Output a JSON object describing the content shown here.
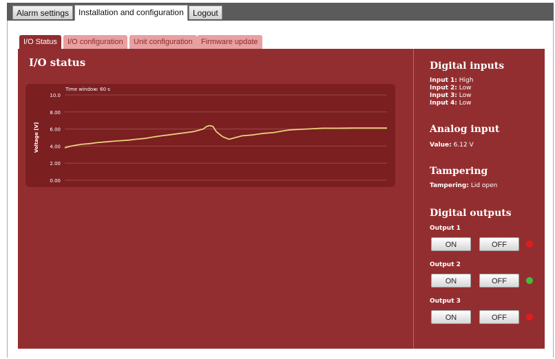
{
  "top_tabs": [
    "Alarm settings",
    "Installation and configuration",
    "Logout"
  ],
  "sub_tabs": [
    "I/O Status",
    "I/O configuration",
    "Unit configuration",
    "Firmware update"
  ],
  "main": {
    "title": "I/O status"
  },
  "chart_data": {
    "type": "line",
    "title": "Time window: 60 s",
    "ylabel": "Voltage [V]",
    "xlabel": "",
    "ylim": [
      0,
      10
    ],
    "ytick_labels": [
      "10.0",
      "8.00",
      "6.00",
      "4.00",
      "2.00",
      "0.00"
    ],
    "series": [
      {
        "x": [
          0,
          2,
          5,
          8,
          10,
          13,
          16,
          20,
          22,
          25,
          28,
          30,
          33,
          36,
          38,
          40,
          41,
          42,
          43,
          44,
          45,
          46,
          47,
          49,
          51,
          53,
          55,
          58,
          60,
          62,
          65,
          68,
          70,
          75,
          80,
          85,
          90,
          100
        ],
        "values": [
          3.8,
          4.0,
          4.2,
          4.3,
          4.4,
          4.5,
          4.6,
          4.7,
          4.8,
          4.9,
          5.1,
          5.2,
          5.35,
          5.5,
          5.6,
          5.7,
          5.8,
          5.9,
          6.0,
          6.3,
          6.4,
          6.3,
          5.7,
          5.1,
          4.8,
          5.0,
          5.2,
          5.3,
          5.4,
          5.5,
          5.6,
          5.8,
          5.9,
          6.0,
          6.1,
          6.1,
          6.12,
          6.12
        ]
      }
    ],
    "line_color": "#e8d27a"
  },
  "right": {
    "digital_inputs": {
      "title": "Digital inputs",
      "items": [
        {
          "label": "Input 1:",
          "value": "High"
        },
        {
          "label": "Input 2:",
          "value": "Low"
        },
        {
          "label": "Input 3:",
          "value": "Low"
        },
        {
          "label": "Input 4:",
          "value": "Low"
        }
      ]
    },
    "analog_input": {
      "title": "Analog input",
      "label": "Value:",
      "value": "6.12 V"
    },
    "tampering": {
      "title": "Tampering",
      "label": "Tampering:",
      "value": "Lid open"
    },
    "digital_outputs": {
      "title": "Digital outputs",
      "outputs": [
        {
          "label": "Output 1",
          "on": "ON",
          "off": "OFF",
          "led_color": "#e21c1c"
        },
        {
          "label": "Output 2",
          "on": "ON",
          "off": "OFF",
          "led_color": "#3fbf3a"
        },
        {
          "label": "Output 3",
          "on": "ON",
          "off": "OFF",
          "led_color": "#e21c1c"
        }
      ]
    }
  },
  "colors": {
    "panel": "#932e30",
    "chart_bg": "#7b1f21",
    "tab_inactive": "#e8a0a0"
  }
}
